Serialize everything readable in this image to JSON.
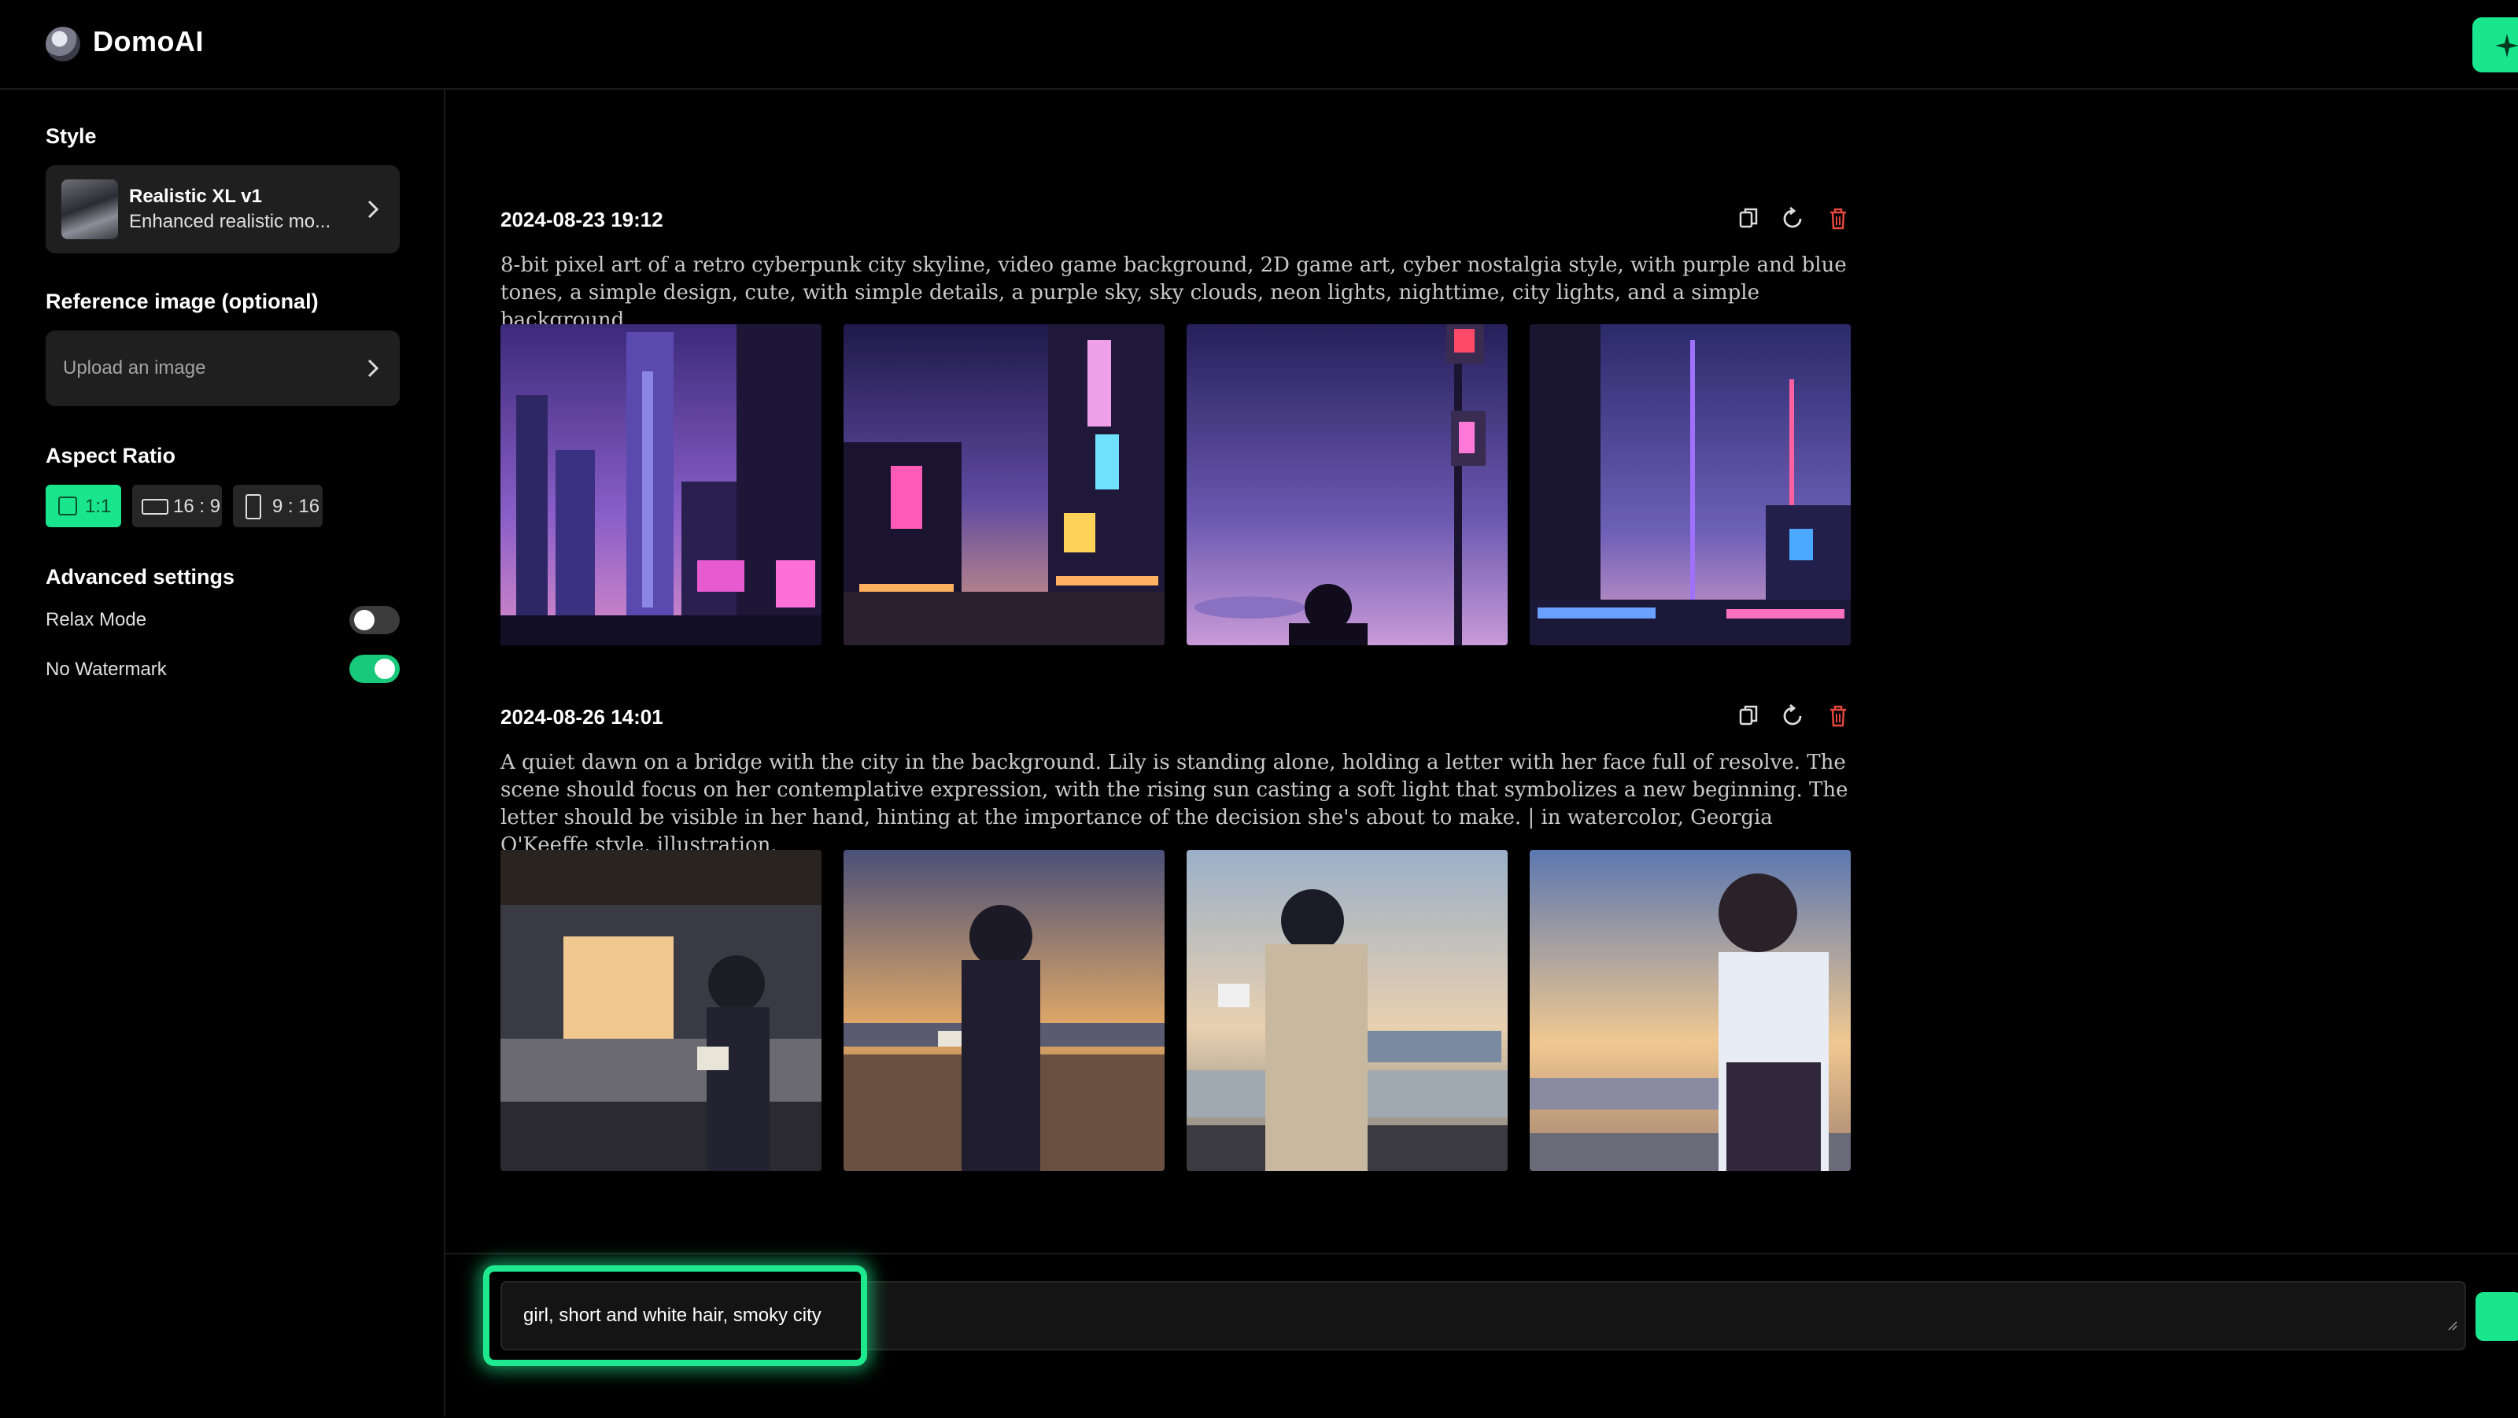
{
  "app": {
    "name": "DomoAI"
  },
  "sidebar": {
    "style_title": "Style",
    "style_name": "Realistic XL v1",
    "style_desc": "Enhanced realistic mo...",
    "reference_title": "Reference image (optional)",
    "upload_label": "Upload an image",
    "aspect_title": "Aspect Ratio",
    "ratios": [
      {
        "label": "1:1",
        "active": true
      },
      {
        "label": "16 : 9",
        "active": false
      },
      {
        "label": "9 : 16",
        "active": false
      }
    ],
    "advanced_title": "Advanced settings",
    "relax_label": "Relax Mode",
    "relax_on": false,
    "watermark_label": "No Watermark",
    "watermark_on": true
  },
  "generations": [
    {
      "date": "2024-08-23 19:12",
      "prompt": "8-bit pixel art of a retro cyberpunk city skyline, video game background, 2D game art, cyber nostalgia style, with purple and blue tones, a simple design, cute, with simple details, a purple sky, sky clouds, neon lights, nighttime, city lights, and a simple background."
    },
    {
      "date": "2024-08-26 14:01",
      "prompt": "A quiet dawn on a bridge with the city in the background. Lily is standing alone, holding a letter with her face full of resolve. The scene should focus on her contemplative expression, with the rising sun casting a soft light that symbolizes a new beginning. The letter should be visible in her hand, hinting at the importance of the decision she's about to make. | in watercolor, Georgia O'Keeffe style, illustration."
    }
  ],
  "composer": {
    "value": "girl, short and white hair, smoky city"
  },
  "colors": {
    "accent": "#19e68c",
    "delete": "#e5483d"
  }
}
